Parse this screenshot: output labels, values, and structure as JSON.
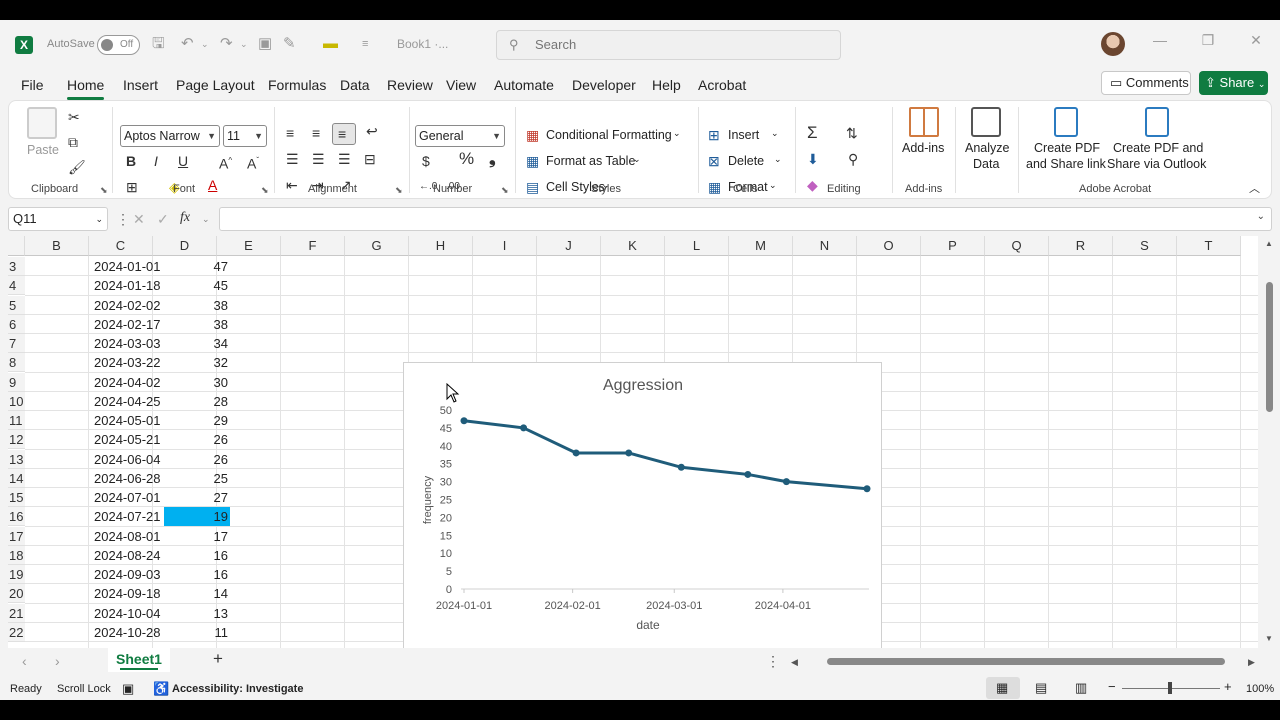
{
  "titlebar": {
    "app_icon": "excel-logo",
    "autosave_label": "AutoSave",
    "autosave_state": "Off",
    "book_name": "Book1 ·...",
    "search_placeholder": "Search"
  },
  "menu": {
    "tabs": [
      "File",
      "Home",
      "Insert",
      "Page Layout",
      "Formulas",
      "Data",
      "Review",
      "View",
      "Automate",
      "Developer",
      "Help",
      "Acrobat"
    ],
    "active_tab": "Home",
    "comments_label": "Comments",
    "share_label": "Share"
  },
  "ribbon": {
    "clipboard": {
      "paste_label": "Paste",
      "group_label": "Clipboard"
    },
    "font": {
      "font_name": "Aptos Narrow",
      "font_size": "11",
      "group_label": "Font"
    },
    "alignment": {
      "group_label": "Alignment"
    },
    "number": {
      "format": "General",
      "group_label": "Number"
    },
    "styles": {
      "conditional_formatting": "Conditional Formatting",
      "format_as_table": "Format as Table",
      "cell_styles": "Cell Styles",
      "group_label": "Styles"
    },
    "cells": {
      "insert": "Insert",
      "delete": "Delete",
      "format": "Format",
      "group_label": "Cells"
    },
    "editing": {
      "group_label": "Editing"
    },
    "addins": {
      "button_label": "Add-ins",
      "group_label": "Add-ins"
    },
    "analyze": {
      "line1": "Analyze",
      "line2": "Data"
    },
    "acrobat": {
      "create_share_1": "Create PDF",
      "create_share_2": "and Share link",
      "create_outlook_1": "Create PDF and",
      "create_outlook_2": "Share via Outlook",
      "group_label": "Adobe Acrobat"
    }
  },
  "formula_bar": {
    "name_box": "Q11",
    "fx_label": "fx",
    "formula": ""
  },
  "grid": {
    "columns": [
      "B",
      "C",
      "D",
      "E",
      "F",
      "G",
      "H",
      "I",
      "J",
      "K",
      "L",
      "M",
      "N",
      "O",
      "P",
      "Q",
      "R",
      "S",
      "T"
    ],
    "rows": [
      {
        "row": "3",
        "date": "2024-01-01",
        "value": "47"
      },
      {
        "row": "4",
        "date": "2024-01-18",
        "value": "45"
      },
      {
        "row": "5",
        "date": "2024-02-02",
        "value": "38"
      },
      {
        "row": "6",
        "date": "2024-02-17",
        "value": "38"
      },
      {
        "row": "7",
        "date": "2024-03-03",
        "value": "34"
      },
      {
        "row": "8",
        "date": "2024-03-22",
        "value": "32"
      },
      {
        "row": "9",
        "date": "2024-04-02",
        "value": "30"
      },
      {
        "row": "10",
        "date": "2024-04-25",
        "value": "28"
      },
      {
        "row": "11",
        "date": "2024-05-01",
        "value": "29"
      },
      {
        "row": "12",
        "date": "2024-05-21",
        "value": "26"
      },
      {
        "row": "13",
        "date": "2024-06-04",
        "value": "26"
      },
      {
        "row": "14",
        "date": "2024-06-28",
        "value": "25"
      },
      {
        "row": "15",
        "date": "2024-07-01",
        "value": "27"
      },
      {
        "row": "16",
        "date": "2024-07-21",
        "value": "19"
      },
      {
        "row": "17",
        "date": "2024-08-01",
        "value": "17"
      },
      {
        "row": "18",
        "date": "2024-08-24",
        "value": "16"
      },
      {
        "row": "19",
        "date": "2024-09-03",
        "value": "16"
      },
      {
        "row": "20",
        "date": "2024-09-18",
        "value": "14"
      },
      {
        "row": "21",
        "date": "2024-10-04",
        "value": "13"
      },
      {
        "row": "22",
        "date": "2024-10-28",
        "value": "11"
      }
    ],
    "selected_row": "16"
  },
  "chart_data": {
    "type": "line",
    "title": "Aggression",
    "xlabel": "date",
    "ylabel": "frequency",
    "x": [
      "2024-01-01",
      "2024-01-18",
      "2024-02-02",
      "2024-02-17",
      "2024-03-03",
      "2024-03-22",
      "2024-04-02",
      "2024-04-25"
    ],
    "values": [
      47,
      45,
      38,
      38,
      34,
      32,
      30,
      28
    ],
    "ylim": [
      0,
      50
    ],
    "yticks": [
      "0",
      "5",
      "10",
      "15",
      "20",
      "25",
      "30",
      "35",
      "40",
      "45",
      "50"
    ],
    "xticks": [
      "2024-01-01",
      "2024-02-01",
      "2024-03-01",
      "2024-04-01"
    ],
    "color": "#1f5c7a",
    "grid": false,
    "legend": "none"
  },
  "sheets": {
    "tabs": [
      "Sheet1"
    ],
    "active": "Sheet1"
  },
  "status": {
    "ready": "Ready",
    "scroll_lock": "Scroll Lock",
    "accessibility": "Accessibility: Investigate",
    "zoom": "100%"
  },
  "colors": {
    "accent": "#107c41",
    "selection": "#00b0f0"
  }
}
